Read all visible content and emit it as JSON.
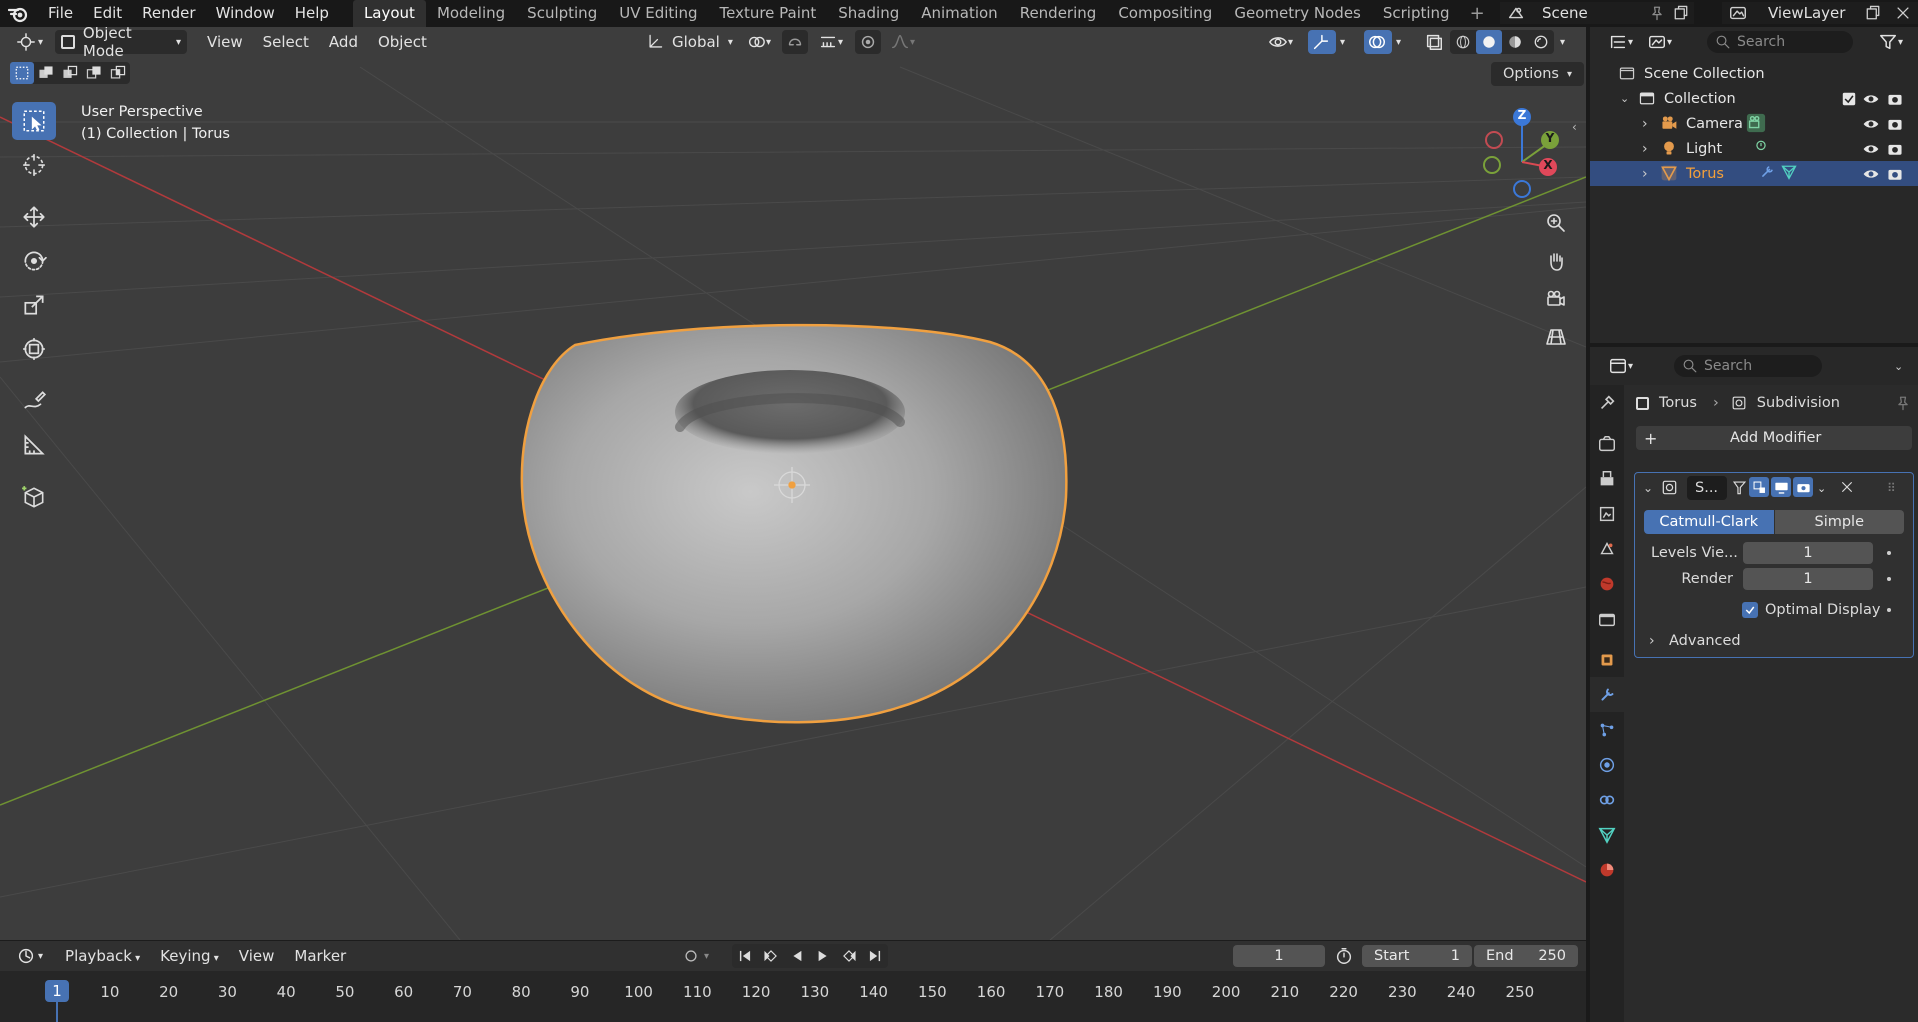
{
  "topbar": {
    "menus": [
      "File",
      "Edit",
      "Render",
      "Window",
      "Help"
    ],
    "workspaces": [
      "Layout",
      "Modeling",
      "Sculpting",
      "UV Editing",
      "Texture Paint",
      "Shading",
      "Animation",
      "Rendering",
      "Compositing",
      "Geometry Nodes",
      "Scripting"
    ],
    "active_workspace": "Layout",
    "scene": "Scene",
    "view_layer": "ViewLayer"
  },
  "viewport": {
    "mode": "Object Mode",
    "menus": [
      "View",
      "Select",
      "Add",
      "Object"
    ],
    "transform_orientation": "Global",
    "options_label": "Options",
    "perspective": "User Perspective",
    "collection_info": "(1) Collection | Torus",
    "gizmo_axes": {
      "x": "X",
      "y": "Y",
      "z": "Z"
    },
    "colors": {
      "bg": "#3d3d3d",
      "x_axis": "#c0393b",
      "y_axis": "#7aa13a",
      "selection": "#f5a03a",
      "active": "#4772b3"
    }
  },
  "outliner": {
    "search_placeholder": "Search",
    "scene_collection": "Scene Collection",
    "collection": "Collection",
    "items": [
      {
        "label": "Camera",
        "icon": "camera-icon"
      },
      {
        "label": "Light",
        "icon": "light-icon"
      },
      {
        "label": "Torus",
        "icon": "mesh-icon",
        "selected": true
      }
    ]
  },
  "properties": {
    "search_placeholder": "Search",
    "breadcrumb_object": "Torus",
    "breadcrumb_modifier": "Subdivision",
    "add_modifier": "Add Modifier",
    "modifier_name": "S...",
    "algorithms": [
      "Catmull-Clark",
      "Simple"
    ],
    "active_algorithm": "Catmull-Clark",
    "levels_viewport_label": "Levels Vie...",
    "levels_viewport": "1",
    "render_label": "Render",
    "render_levels": "1",
    "optimal_display_label": "Optimal Display",
    "optimal_display": true,
    "advanced_label": "Advanced"
  },
  "timeline": {
    "menus": [
      "Playback",
      "Keying",
      "View",
      "Marker"
    ],
    "current_frame": "1",
    "start_label": "Start",
    "start": "1",
    "end_label": "End",
    "end": "250",
    "ruler": [
      "1",
      "10",
      "20",
      "30",
      "40",
      "50",
      "60",
      "70",
      "80",
      "90",
      "100",
      "110",
      "120",
      "130",
      "140",
      "150",
      "160",
      "170",
      "180",
      "190",
      "200",
      "210",
      "220",
      "230",
      "240",
      "250"
    ]
  }
}
